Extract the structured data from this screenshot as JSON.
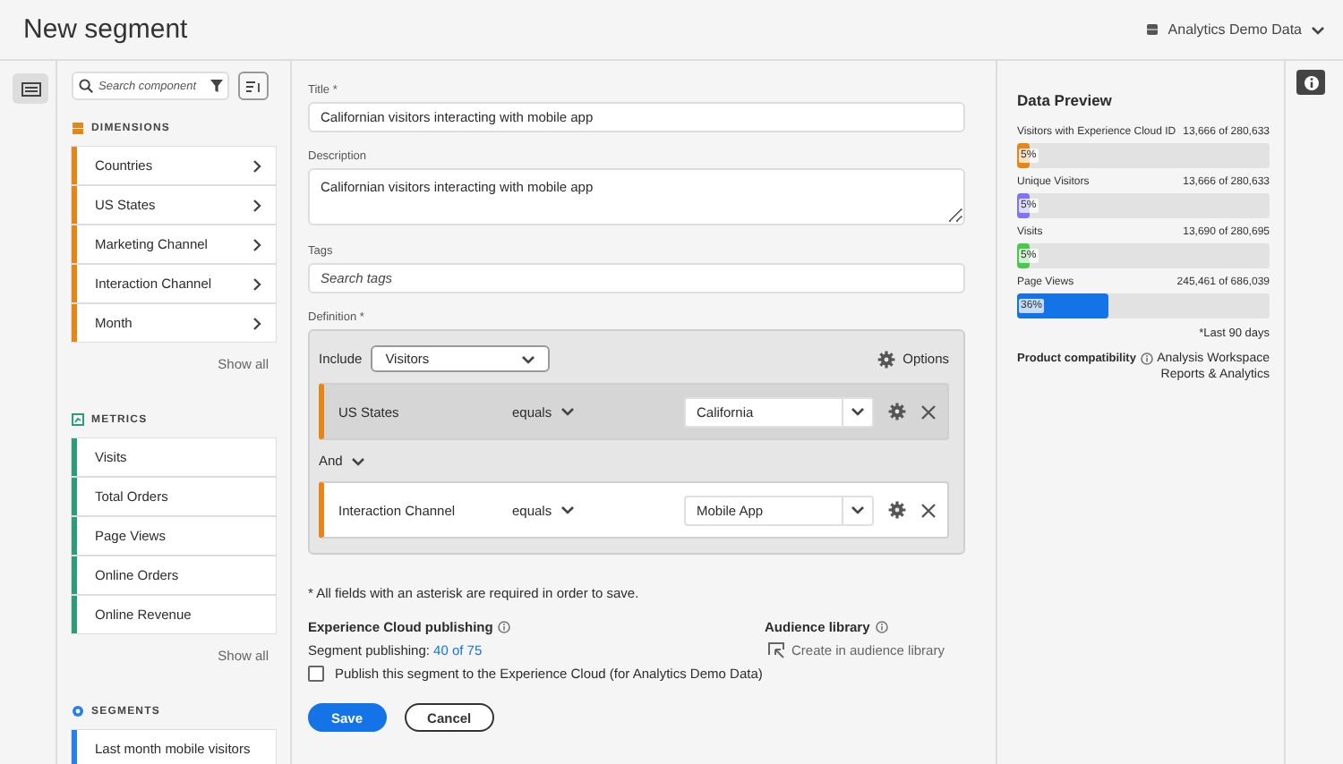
{
  "header": {
    "title": "New segment",
    "report_suite": "Analytics Demo Data"
  },
  "components": {
    "search": {
      "placeholder": "Search component"
    },
    "sections": [
      {
        "kind": "dimensions",
        "title": "DIMENSIONS",
        "color": "#e68619",
        "items": [
          "Countries",
          "US States",
          "Marketing Channel",
          "Interaction Channel",
          "Month"
        ],
        "show_all": "Show all"
      },
      {
        "kind": "metrics",
        "title": "METRICS",
        "color": "#2d9d78",
        "items": [
          "Visits",
          "Total Orders",
          "Page Views",
          "Online Orders",
          "Online Revenue"
        ],
        "show_all": "Show all"
      },
      {
        "kind": "segments",
        "title": "SEGMENTS",
        "color": "#2680eb",
        "items": [
          "Last month mobile visitors"
        ]
      }
    ]
  },
  "form": {
    "title_label": "Title *",
    "title_value": "Californian visitors interacting with mobile app",
    "description_label": "Description",
    "description_value": "Californian visitors interacting with mobile app",
    "tags_label": "Tags",
    "tags_placeholder": "Search tags",
    "definition_label": "Definition *",
    "definition": {
      "include_label": "Include",
      "container": "Visitors",
      "options": "Options",
      "connector": "And",
      "rules": [
        {
          "dimension": "US States",
          "operator": "equals",
          "value": "California",
          "selected": true
        },
        {
          "dimension": "Interaction Channel",
          "operator": "equals",
          "value": "Mobile App",
          "selected": false
        }
      ]
    },
    "required_note": "* All fields with an asterisk are required in order to save.",
    "publishing": {
      "heading": "Experience Cloud publishing",
      "line": "Segment publishing:",
      "link": "40 of 75",
      "checkbox_label": "Publish this segment to the Experience Cloud (for Analytics Demo Data)",
      "checked": false
    },
    "audience": {
      "heading": "Audience library",
      "action": "Create in audience library"
    },
    "buttons": [
      {
        "label": "Save",
        "kind": "primary"
      },
      {
        "label": "Cancel",
        "kind": "secondary"
      }
    ]
  },
  "preview": {
    "title": "Data Preview",
    "metrics": [
      {
        "name": "Visitors with Experience Cloud ID",
        "count": "13,666 of 280,633",
        "level": 0.05,
        "reading": "5%",
        "color": "#e68619"
      },
      {
        "name": "Unique Visitors",
        "count": "13,666 of 280,633",
        "level": 0.05,
        "reading": "5%",
        "color": "#7e75f5"
      },
      {
        "name": "Visits",
        "count": "13,690 of 280,695",
        "level": 0.05,
        "reading": "5%",
        "color": "#49c94b"
      },
      {
        "name": "Page Views",
        "count": "245,461 of 686,039",
        "level": 0.36,
        "reading": "36%",
        "color": "#1473e6"
      }
    ],
    "note": "*Last 90 days",
    "compatibility_label": "Product compatibility",
    "products": [
      "Analysis Workspace",
      "Reports & Analytics"
    ]
  }
}
